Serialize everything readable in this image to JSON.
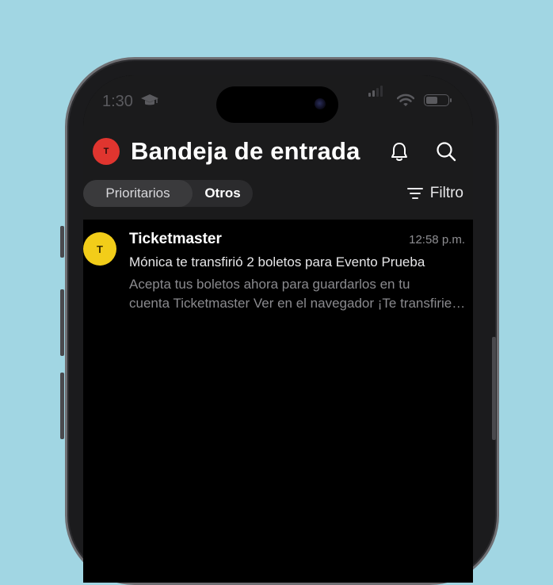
{
  "status_bar": {
    "time": "1:30"
  },
  "header": {
    "account_avatar_letter": "T",
    "title": "Bandeja de entrada"
  },
  "tabs": [
    {
      "label": "Prioritarios",
      "selected": true
    },
    {
      "label": "Otros",
      "selected": false
    }
  ],
  "filter_label": "Filtro",
  "emails": [
    {
      "avatar_letter": "T",
      "sender": "Ticketmaster",
      "time": "12:58 p.m.",
      "subject": "Mónica te transfirió 2 boletos para Evento Prueba",
      "preview_line1": "Acepta tus boletos ahora para guardarlos en tu",
      "preview_line2": "cuenta Ticketmaster Ver en el navegador ¡Te transfirieron"
    }
  ],
  "colors": {
    "background": "#a1d6e3",
    "account_avatar": "#e0352f",
    "sender_avatar": "#f2cd19"
  }
}
